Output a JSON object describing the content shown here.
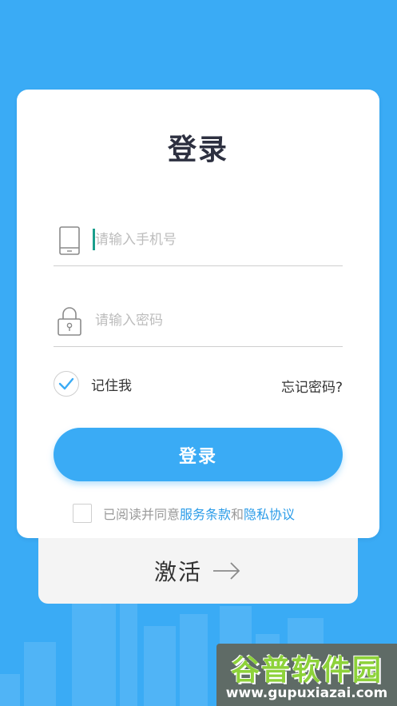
{
  "colors": {
    "background": "#3aabf5",
    "primary": "#3aabf5",
    "link": "#2b9ce8",
    "card": "#ffffff",
    "cursor": "#1a9e8c"
  },
  "login": {
    "title": "登录",
    "phone_placeholder": "请输入手机号",
    "phone_icon": "phone-icon",
    "password_placeholder": "请输入密码",
    "password_icon": "lock-icon",
    "remember_label": "记住我",
    "remember_checked": true,
    "forgot_label": "忘记密码?",
    "submit_label": "登录",
    "agree_prefix": "已阅读并同意",
    "terms_link": "服务条款",
    "agree_and": "和",
    "privacy_link": "隐私协议"
  },
  "activate": {
    "label": "激活",
    "icon": "arrow-right-icon"
  },
  "watermark": {
    "title": "谷普软件园",
    "url": "www.gupuxiazai.com"
  }
}
